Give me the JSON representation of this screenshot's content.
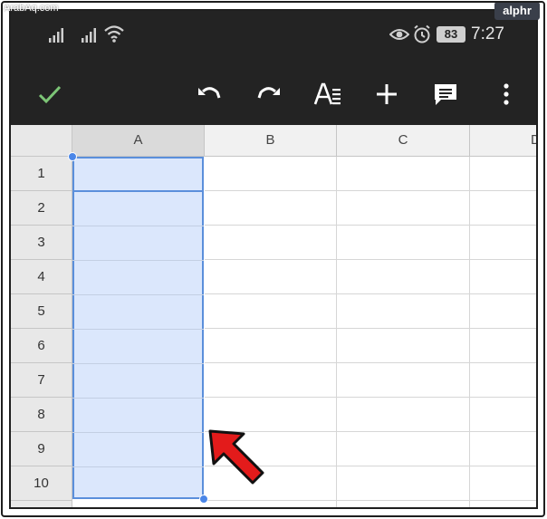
{
  "watermarks": {
    "site_left": "ArabAq.com",
    "brand_right": "alphr"
  },
  "status_bar": {
    "battery": "83",
    "time": "7:27",
    "icons": [
      "signal-icon",
      "signal-icon",
      "wifi-icon",
      "eye-icon",
      "alarm-icon"
    ]
  },
  "toolbar": {
    "buttons": [
      "check-icon",
      "undo-icon",
      "redo-icon",
      "text-format-icon",
      "add-icon",
      "comment-icon",
      "more-vert-icon"
    ],
    "check_color": "#7cc576"
  },
  "grid": {
    "columns": [
      "A",
      "B",
      "C",
      "D"
    ],
    "rows": [
      "1",
      "2",
      "3",
      "4",
      "5",
      "6",
      "7",
      "8",
      "9",
      "10"
    ],
    "selected_column": "A",
    "selection_color": "#dbe7fc",
    "selection_border": "#5b8fdb"
  },
  "annotation": {
    "arrow_color": "#e31b1b"
  }
}
